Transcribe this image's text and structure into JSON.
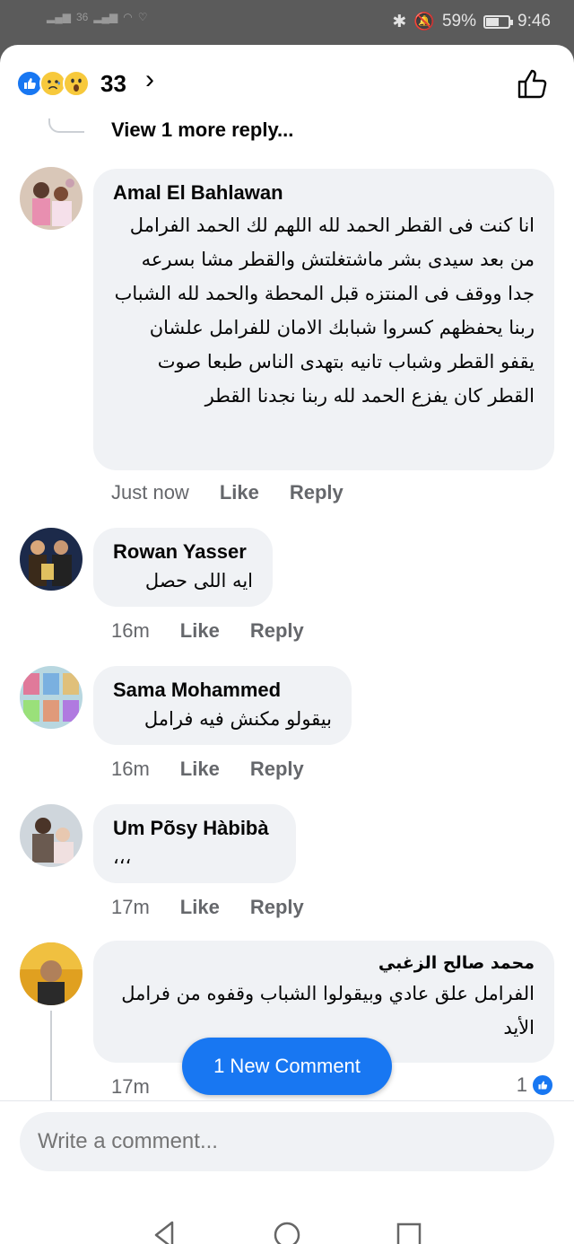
{
  "status": {
    "signal_text": "36",
    "battery_pct": "59%",
    "time": "9:46"
  },
  "reactions": {
    "count": "33",
    "icons": [
      "like-icon",
      "sad-icon",
      "wow-icon"
    ]
  },
  "view_more": "View 1 more reply...",
  "comments": [
    {
      "author": "Amal El Bahlawan",
      "text": "انا كنت فى القطر الحمد لله اللهم لك الحمد الفرامل من بعد سيدى بشر ماشتغلتش والقطر مشا بسرعه جدا ووقف فى المنتزه قبل المحطة والحمد لله الشباب ربنا يحفظهم كسروا شبابك الامان للفرامل علشان يقفو القطر وشباب تانيه بتهدى الناس طبعا صوت القطر كان يفزع الحمد لله ربنا نجدنا القطر",
      "time": "Just now",
      "like": "Like",
      "reply": "Reply"
    },
    {
      "author": "Rowan Yasser",
      "text": "ايه اللى حصل",
      "time": "16m",
      "like": "Like",
      "reply": "Reply"
    },
    {
      "author": "Sama Mohammed",
      "text": "بيقولو مكنش فيه فرامل",
      "time": "16m",
      "like": "Like",
      "reply": "Reply"
    },
    {
      "author": "Um Põsy Hàbibà",
      "text": "،،،",
      "time": "17m",
      "like": "Like",
      "reply": "Reply"
    },
    {
      "author": "محمد صالح الزغبي",
      "text": "الفرامل علق عادي وبيقولوا الشباب وقفوه من فرامل الأيد",
      "time": "17m",
      "reaction_count": "1"
    }
  ],
  "new_comment": "1 New Comment",
  "composer": {
    "placeholder": "Write a comment..."
  },
  "colors": {
    "accent": "#1877f2",
    "bubble": "#f0f2f5",
    "meta": "#65676b"
  }
}
